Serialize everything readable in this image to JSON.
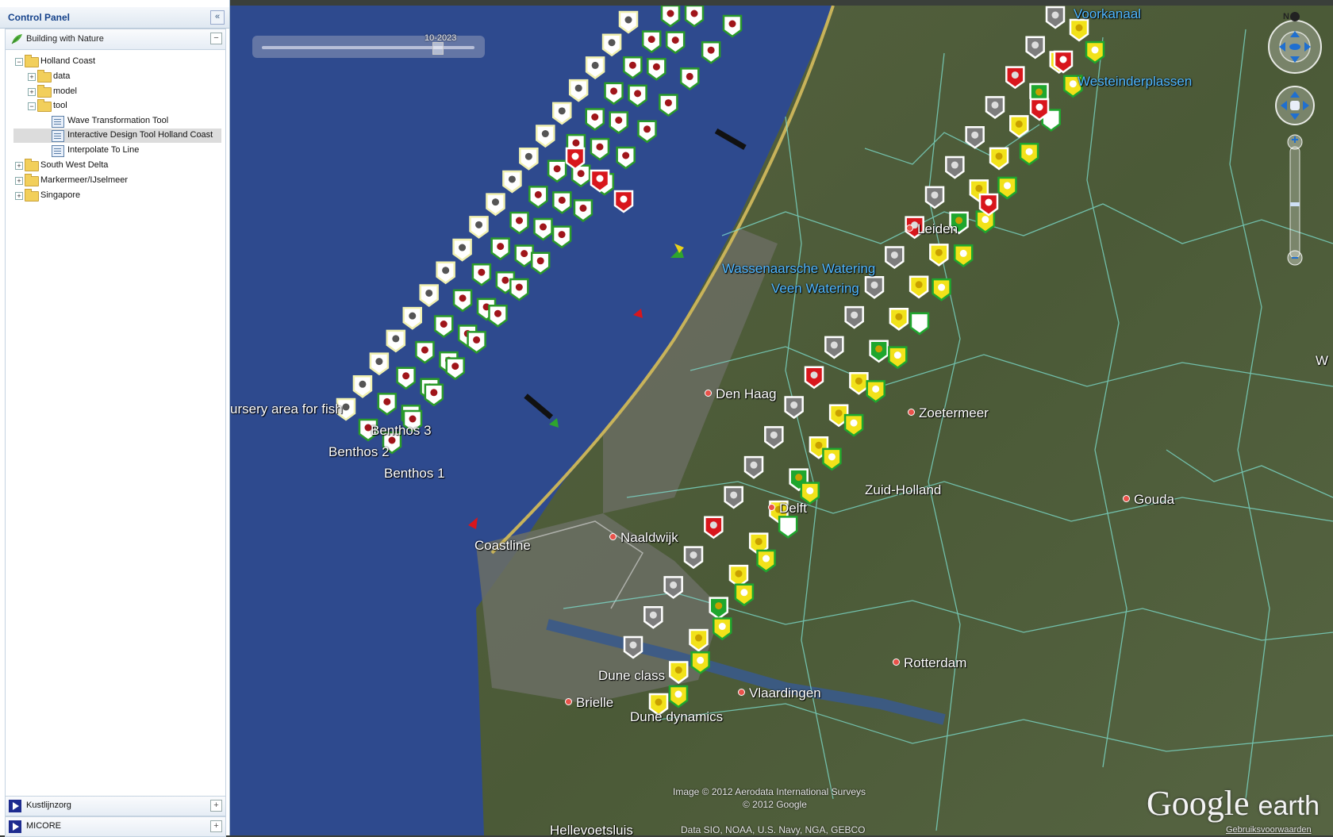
{
  "control_panel": {
    "title": "Control Panel",
    "collapse_label": "«",
    "section": {
      "label": "Building with Nature",
      "toggle": "−"
    },
    "tree": [
      {
        "label": "Holland Coast",
        "expander": "−"
      },
      {
        "label": "data",
        "expander": "+"
      },
      {
        "label": "model",
        "expander": "+"
      },
      {
        "label": "tool",
        "expander": "−"
      },
      {
        "label": "Wave Transformation Tool"
      },
      {
        "label": "Interactive Design Tool Holland Coast",
        "selected": true
      },
      {
        "label": "Interpolate To Line"
      },
      {
        "label": "South West Delta",
        "expander": "+"
      },
      {
        "label": "Markermeer/IJselmeer",
        "expander": "+"
      },
      {
        "label": "Singapore",
        "expander": "+"
      }
    ],
    "bottom_items": [
      {
        "label": "Kustlijnzorg",
        "toggle": "+"
      },
      {
        "label": "MICORE",
        "toggle": "+"
      }
    ]
  },
  "map": {
    "time_slider": {
      "date": "10-2023"
    },
    "labels": {
      "voorkanaal": "Voorkanaal",
      "westeinderplassen": "Westeinderplassen",
      "leiden": "Leiden",
      "wassenaarsche": "Wassenaarsche Watering",
      "veen": "Veen Watering",
      "nursery": "ursery area for fish",
      "benthos3": "Benthos 3",
      "benthos2": "Benthos 2",
      "benthos1": "Benthos 1",
      "den_haag": "Den Haag",
      "zoetermeer": "Zoetermeer",
      "delft": "Delft",
      "zuid_holland": "Zuid-Holland",
      "gouda": "Gouda",
      "coastline": "Coastline",
      "naaldwijk": "Naaldwijk",
      "rotterdam": "Rotterdam",
      "dune_class": "Dune class",
      "vlaardingen": "Vlaardingen",
      "brielle": "Brielle",
      "dune_dynamics": "Dune dynamics",
      "hellevoetsluis": "Hellevoetsluis",
      "edge_w": "W"
    },
    "credits": {
      "imagery": "Image © 2012 Aerodata International Surveys",
      "copyright": "© 2012 Google",
      "data": "Data SIO, NOAA, U.S. Navy, NGA, GEBCO"
    },
    "logo": {
      "brand": "Google",
      "product": "earth"
    },
    "terms_link": "Gebruiksvoorwaarden",
    "north_label": "N",
    "colors": {
      "sea": "#2e4a8e",
      "land": "#4a5a38",
      "urban": "#6b6e64",
      "boundary": "#7ee0d0",
      "marker_green": "#1fa62e",
      "marker_red": "#d8161c",
      "marker_yellow": "#f2e21a",
      "marker_gray": "#7d7d7d",
      "marker_white": "#ffffff"
    }
  }
}
